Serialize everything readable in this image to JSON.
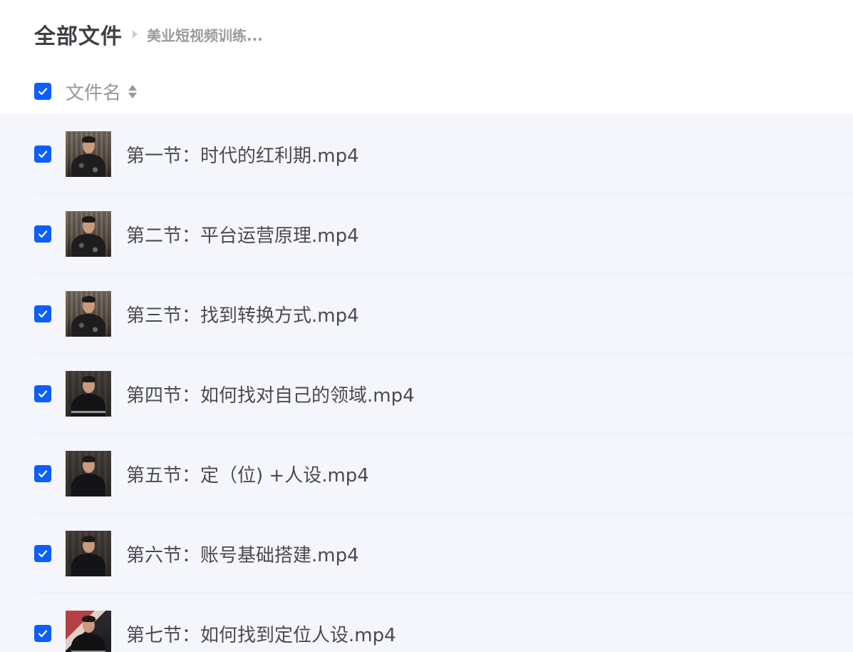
{
  "breadcrumb": {
    "root": "全部文件",
    "current": "美业短视频训练..."
  },
  "list_header": {
    "column_name": "文件名",
    "select_all_checked": true,
    "sort_icon": "sort-updown-icon"
  },
  "colors": {
    "accent": "#0d5efb",
    "list_background": "#f5f6fc",
    "text_primary": "#4a4b50",
    "text_secondary": "#96979c"
  },
  "files": [
    {
      "name": "第一节：时代的红利期.mp4",
      "checked": true,
      "thumbnail": "video-thumbnail"
    },
    {
      "name": "第二节：平台运营原理.mp4",
      "checked": true,
      "thumbnail": "video-thumbnail"
    },
    {
      "name": "第三节：找到转换方式.mp4",
      "checked": true,
      "thumbnail": "video-thumbnail"
    },
    {
      "name": "第四节：如何找对自己的领域.mp4",
      "checked": true,
      "thumbnail": "video-thumbnail"
    },
    {
      "name": "第五节：定（位) +人设.mp4",
      "checked": true,
      "thumbnail": "video-thumbnail"
    },
    {
      "name": "第六节：账号基础搭建.mp4",
      "checked": true,
      "thumbnail": "video-thumbnail"
    },
    {
      "name": "第七节：如何找到定位人设.mp4",
      "checked": true,
      "thumbnail": "video-thumbnail"
    }
  ]
}
